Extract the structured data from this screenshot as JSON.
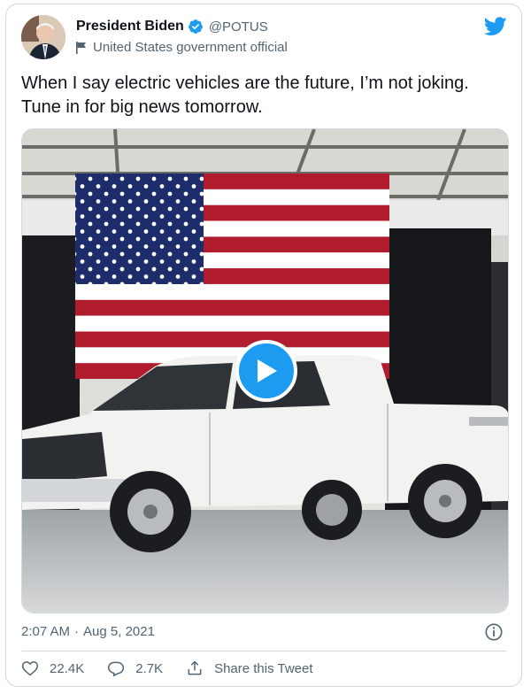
{
  "author": {
    "display_name": "President Biden",
    "handle": "@POTUS",
    "affiliation": "United States government official"
  },
  "tweet": {
    "text_line1": "When I say electric vehicles are the future, I’m not joking.",
    "text_line2": "Tune in for big news tomorrow.",
    "time": "2:07 AM",
    "separator": "·",
    "date": "Aug 5, 2021"
  },
  "actions": {
    "likes": "22.4K",
    "replies": "2.7K",
    "share_label": "Share this Tweet"
  },
  "colors": {
    "accent": "#1d9bf0",
    "text": "#0f1419",
    "muted": "#536471",
    "border": "#cfd9de"
  },
  "icons": [
    "verified-badge-icon",
    "government-flag-icon",
    "twitter-bird-icon",
    "play-icon",
    "info-icon",
    "heart-icon",
    "reply-icon",
    "share-icon"
  ]
}
